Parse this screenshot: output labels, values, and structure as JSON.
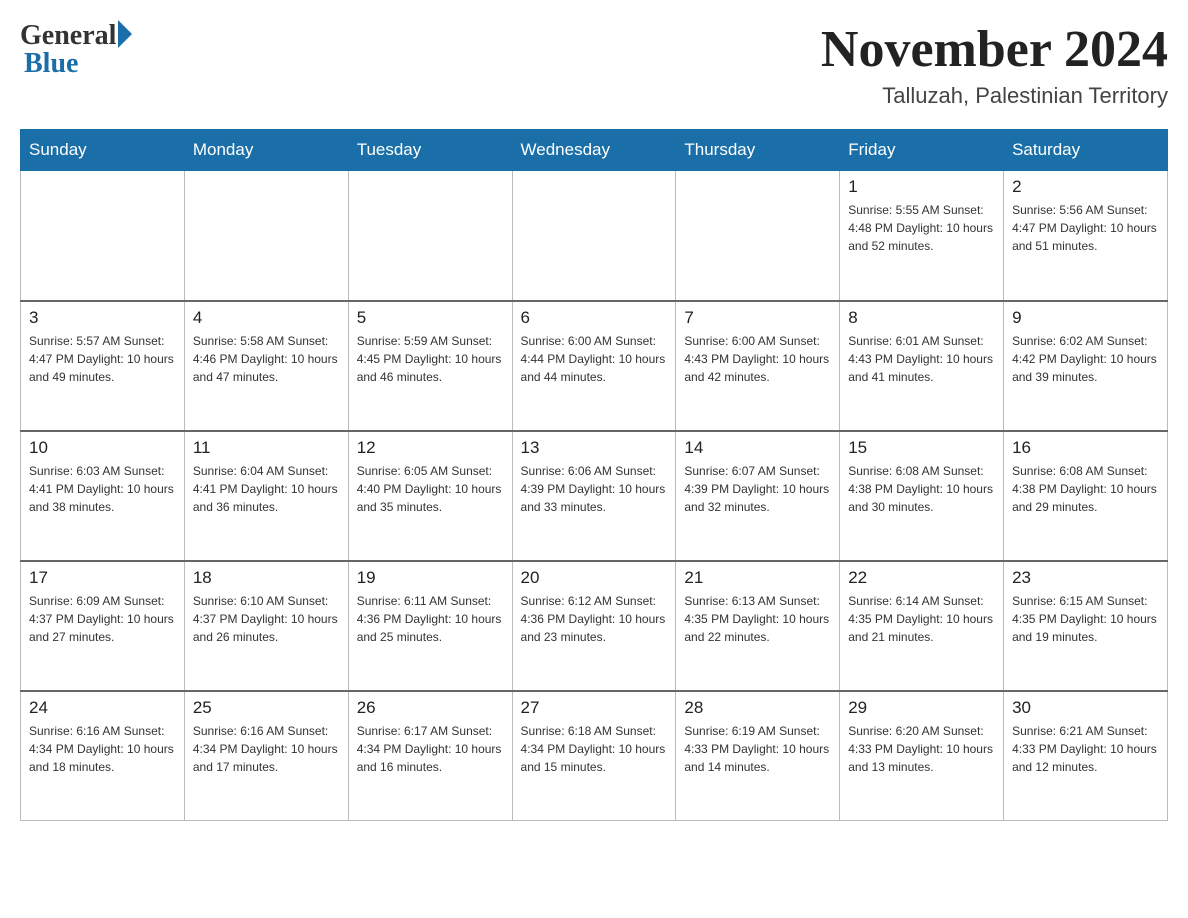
{
  "header": {
    "logo_general": "General",
    "logo_blue": "Blue",
    "month_year": "November 2024",
    "location": "Talluzah, Palestinian Territory"
  },
  "weekdays": [
    "Sunday",
    "Monday",
    "Tuesday",
    "Wednesday",
    "Thursday",
    "Friday",
    "Saturday"
  ],
  "weeks": [
    [
      {
        "day": "",
        "info": ""
      },
      {
        "day": "",
        "info": ""
      },
      {
        "day": "",
        "info": ""
      },
      {
        "day": "",
        "info": ""
      },
      {
        "day": "",
        "info": ""
      },
      {
        "day": "1",
        "info": "Sunrise: 5:55 AM\nSunset: 4:48 PM\nDaylight: 10 hours\nand 52 minutes."
      },
      {
        "day": "2",
        "info": "Sunrise: 5:56 AM\nSunset: 4:47 PM\nDaylight: 10 hours\nand 51 minutes."
      }
    ],
    [
      {
        "day": "3",
        "info": "Sunrise: 5:57 AM\nSunset: 4:47 PM\nDaylight: 10 hours\nand 49 minutes."
      },
      {
        "day": "4",
        "info": "Sunrise: 5:58 AM\nSunset: 4:46 PM\nDaylight: 10 hours\nand 47 minutes."
      },
      {
        "day": "5",
        "info": "Sunrise: 5:59 AM\nSunset: 4:45 PM\nDaylight: 10 hours\nand 46 minutes."
      },
      {
        "day": "6",
        "info": "Sunrise: 6:00 AM\nSunset: 4:44 PM\nDaylight: 10 hours\nand 44 minutes."
      },
      {
        "day": "7",
        "info": "Sunrise: 6:00 AM\nSunset: 4:43 PM\nDaylight: 10 hours\nand 42 minutes."
      },
      {
        "day": "8",
        "info": "Sunrise: 6:01 AM\nSunset: 4:43 PM\nDaylight: 10 hours\nand 41 minutes."
      },
      {
        "day": "9",
        "info": "Sunrise: 6:02 AM\nSunset: 4:42 PM\nDaylight: 10 hours\nand 39 minutes."
      }
    ],
    [
      {
        "day": "10",
        "info": "Sunrise: 6:03 AM\nSunset: 4:41 PM\nDaylight: 10 hours\nand 38 minutes."
      },
      {
        "day": "11",
        "info": "Sunrise: 6:04 AM\nSunset: 4:41 PM\nDaylight: 10 hours\nand 36 minutes."
      },
      {
        "day": "12",
        "info": "Sunrise: 6:05 AM\nSunset: 4:40 PM\nDaylight: 10 hours\nand 35 minutes."
      },
      {
        "day": "13",
        "info": "Sunrise: 6:06 AM\nSunset: 4:39 PM\nDaylight: 10 hours\nand 33 minutes."
      },
      {
        "day": "14",
        "info": "Sunrise: 6:07 AM\nSunset: 4:39 PM\nDaylight: 10 hours\nand 32 minutes."
      },
      {
        "day": "15",
        "info": "Sunrise: 6:08 AM\nSunset: 4:38 PM\nDaylight: 10 hours\nand 30 minutes."
      },
      {
        "day": "16",
        "info": "Sunrise: 6:08 AM\nSunset: 4:38 PM\nDaylight: 10 hours\nand 29 minutes."
      }
    ],
    [
      {
        "day": "17",
        "info": "Sunrise: 6:09 AM\nSunset: 4:37 PM\nDaylight: 10 hours\nand 27 minutes."
      },
      {
        "day": "18",
        "info": "Sunrise: 6:10 AM\nSunset: 4:37 PM\nDaylight: 10 hours\nand 26 minutes."
      },
      {
        "day": "19",
        "info": "Sunrise: 6:11 AM\nSunset: 4:36 PM\nDaylight: 10 hours\nand 25 minutes."
      },
      {
        "day": "20",
        "info": "Sunrise: 6:12 AM\nSunset: 4:36 PM\nDaylight: 10 hours\nand 23 minutes."
      },
      {
        "day": "21",
        "info": "Sunrise: 6:13 AM\nSunset: 4:35 PM\nDaylight: 10 hours\nand 22 minutes."
      },
      {
        "day": "22",
        "info": "Sunrise: 6:14 AM\nSunset: 4:35 PM\nDaylight: 10 hours\nand 21 minutes."
      },
      {
        "day": "23",
        "info": "Sunrise: 6:15 AM\nSunset: 4:35 PM\nDaylight: 10 hours\nand 19 minutes."
      }
    ],
    [
      {
        "day": "24",
        "info": "Sunrise: 6:16 AM\nSunset: 4:34 PM\nDaylight: 10 hours\nand 18 minutes."
      },
      {
        "day": "25",
        "info": "Sunrise: 6:16 AM\nSunset: 4:34 PM\nDaylight: 10 hours\nand 17 minutes."
      },
      {
        "day": "26",
        "info": "Sunrise: 6:17 AM\nSunset: 4:34 PM\nDaylight: 10 hours\nand 16 minutes."
      },
      {
        "day": "27",
        "info": "Sunrise: 6:18 AM\nSunset: 4:34 PM\nDaylight: 10 hours\nand 15 minutes."
      },
      {
        "day": "28",
        "info": "Sunrise: 6:19 AM\nSunset: 4:33 PM\nDaylight: 10 hours\nand 14 minutes."
      },
      {
        "day": "29",
        "info": "Sunrise: 6:20 AM\nSunset: 4:33 PM\nDaylight: 10 hours\nand 13 minutes."
      },
      {
        "day": "30",
        "info": "Sunrise: 6:21 AM\nSunset: 4:33 PM\nDaylight: 10 hours\nand 12 minutes."
      }
    ]
  ]
}
